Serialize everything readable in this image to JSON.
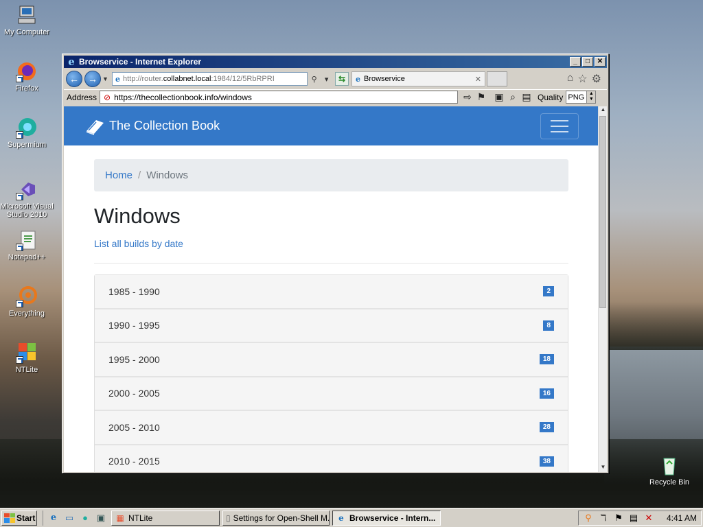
{
  "desktop": {
    "icons": [
      {
        "label": "My Computer"
      },
      {
        "label": "Firefox"
      },
      {
        "label": "Supermium"
      },
      {
        "label": "Microsoft Visual Studio 2010"
      },
      {
        "label": "Notepad++"
      },
      {
        "label": "Everything"
      },
      {
        "label": "NTLite"
      },
      {
        "label": "Recycle Bin"
      }
    ]
  },
  "window": {
    "title": "Browservice - Internet Explorer",
    "url_bar": {
      "prefix": "http://router.",
      "host": "collabnet.local",
      "rest": ":1984/12/5RbRPRI"
    },
    "tab_label": "Browservice",
    "address_label": "Address",
    "address_value": "https://thecollectionbook.info/windows",
    "quality_label": "Quality",
    "quality_value": "PNG"
  },
  "page": {
    "brand": "The Collection Book",
    "breadcrumb": {
      "home": "Home",
      "sep": "/",
      "current": "Windows"
    },
    "title": "Windows",
    "list_link": "List all builds by date",
    "ranges": [
      {
        "label": "1985 - 1990",
        "count": "2"
      },
      {
        "label": "1990 - 1995",
        "count": "8"
      },
      {
        "label": "1995 - 2000",
        "count": "18"
      },
      {
        "label": "2000 - 2005",
        "count": "16"
      },
      {
        "label": "2005 - 2010",
        "count": "28"
      },
      {
        "label": "2010 - 2015",
        "count": "38"
      }
    ]
  },
  "taskbar": {
    "start": "Start",
    "tasks": [
      {
        "label": "NTLite"
      },
      {
        "label": "Settings for Open-Shell M..."
      },
      {
        "label": "Browservice - Intern..."
      }
    ],
    "clock": "4:41 AM"
  }
}
